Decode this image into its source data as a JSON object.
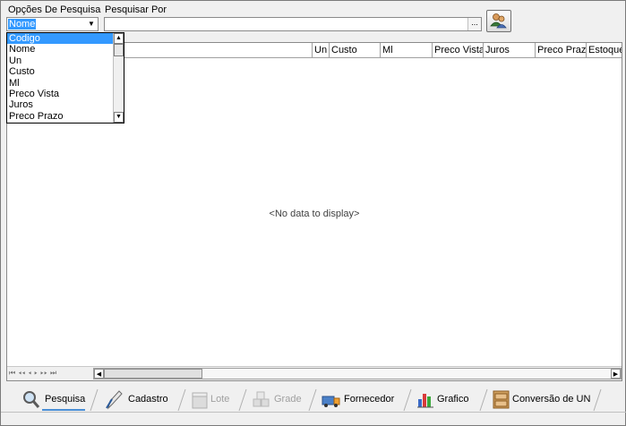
{
  "search": {
    "options_label": "Opções De Pesquisa",
    "search_by_label": "Pesquisar Por",
    "selected_option": "Nome",
    "input_value": "",
    "ellipsis": "...",
    "dropdown_options": [
      "Codigo",
      "Nome",
      "Un",
      "Custo",
      "Ml",
      "Preco Vista",
      "Juros",
      "Preco Prazo"
    ],
    "highlighted_option": "Codigo"
  },
  "grid": {
    "columns": [
      "Un",
      "Custo",
      "Ml",
      "Preco Vista",
      "Juros",
      "Preco Prazo",
      "Estoque"
    ],
    "empty_text": "<No data to display>",
    "nav_glyphs": "⏮ ◂◂ ◂ ▸ ▸▸ ⏭"
  },
  "tabs": [
    {
      "label": "Pesquisa",
      "icon": "magnifier-icon",
      "enabled": true,
      "selected": true
    },
    {
      "label": "Cadastro",
      "icon": "pen-icon",
      "enabled": true,
      "selected": false
    },
    {
      "label": "Lote",
      "icon": "box-icon",
      "enabled": false,
      "selected": false
    },
    {
      "label": "Grade",
      "icon": "grid-boxes-icon",
      "enabled": false,
      "selected": false
    },
    {
      "label": "Fornecedor",
      "icon": "truck-icon",
      "enabled": true,
      "selected": false
    },
    {
      "label": "Grafico",
      "icon": "chart-icon",
      "enabled": true,
      "selected": false
    },
    {
      "label": "Conversão de UN",
      "icon": "cabinet-icon",
      "enabled": true,
      "selected": false
    }
  ],
  "colors": {
    "selection": "#3399ff",
    "accent": "#4a8fd6"
  }
}
